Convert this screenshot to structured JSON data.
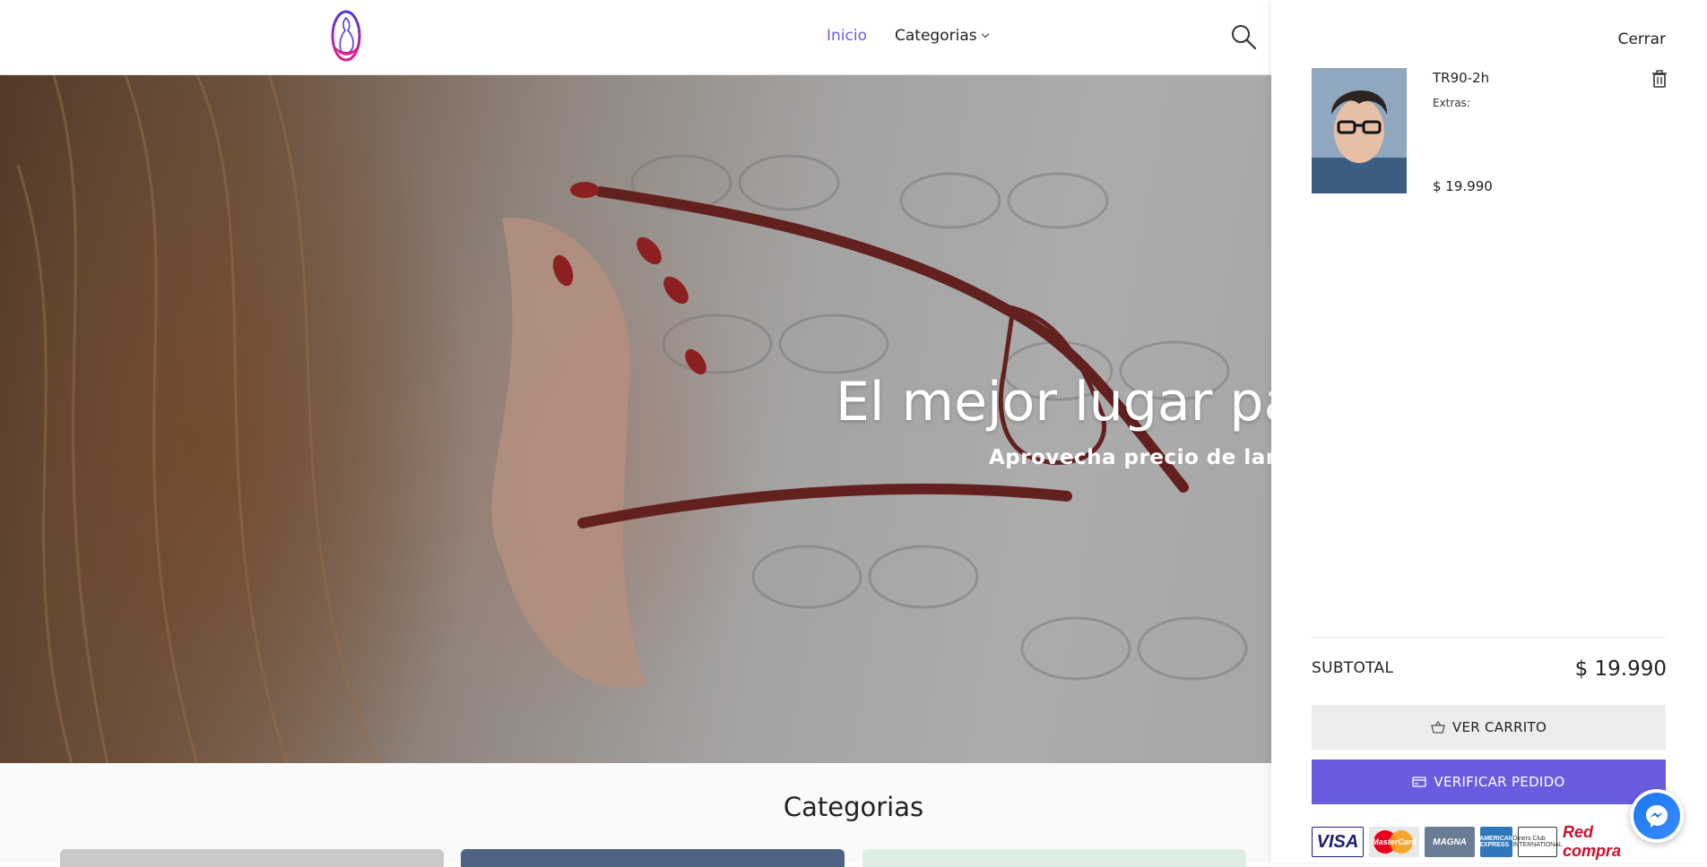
{
  "header": {
    "nav": {
      "home_label": "Inicio",
      "categories_label": "Categorias"
    }
  },
  "hero": {
    "title": "El mejor lugar par",
    "subtitle": "Aprovecha precio de lanz"
  },
  "categories_section": {
    "title": "Categorias"
  },
  "cart_drawer": {
    "close_label": "Cerrar",
    "items": [
      {
        "name": "TR90-2h",
        "extras_label": "Extras:",
        "price": "$ 19.990"
      }
    ],
    "subtotal_label": "SUBTOTAL",
    "subtotal_value": "$ 19.990",
    "view_cart_label": "VER CARRITO",
    "checkout_label": "VERIFICAR PEDIDO",
    "payment_methods": {
      "visa": "VISA",
      "mastercard": "MasterCard",
      "magna": "MAGNA",
      "amex": "AMERICAN EXPRESS",
      "diners": "Diners Club INTERNATIONAL",
      "redcompra": "Red compra"
    }
  },
  "colors": {
    "accent": "#6a5cdf",
    "messenger": "#1877f2"
  }
}
